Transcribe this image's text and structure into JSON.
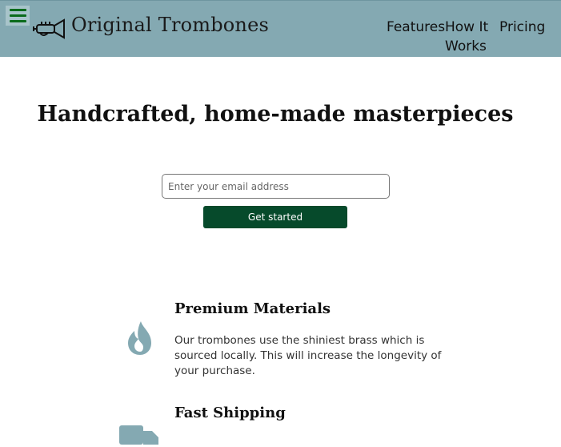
{
  "header": {
    "menu_icon": "hamburger-menu-icon",
    "logo_icon": "trumpet-icon",
    "brand": "Original Trombones",
    "nav": [
      {
        "label": "Features"
      },
      {
        "label": "How It Works"
      },
      {
        "label": "Pricing"
      }
    ],
    "colors": {
      "background": "#84a9b2",
      "menu_bars": "#0b6b1c"
    }
  },
  "hero": {
    "title": "Handcrafted, home-made masterpieces",
    "email_placeholder": "Enter your email address",
    "cta_label": "Get started",
    "colors": {
      "cta_background": "#064a2b",
      "cta_text": "#ffffff"
    }
  },
  "features": [
    {
      "icon": "flame-icon",
      "title": "Premium Materials",
      "description": "Our trombones use the shiniest brass which is sourced locally. This will increase the longevity of your purchase."
    },
    {
      "icon": "truck-icon",
      "title": "Fast Shipping"
    }
  ],
  "icon_color": "#84a9b2"
}
